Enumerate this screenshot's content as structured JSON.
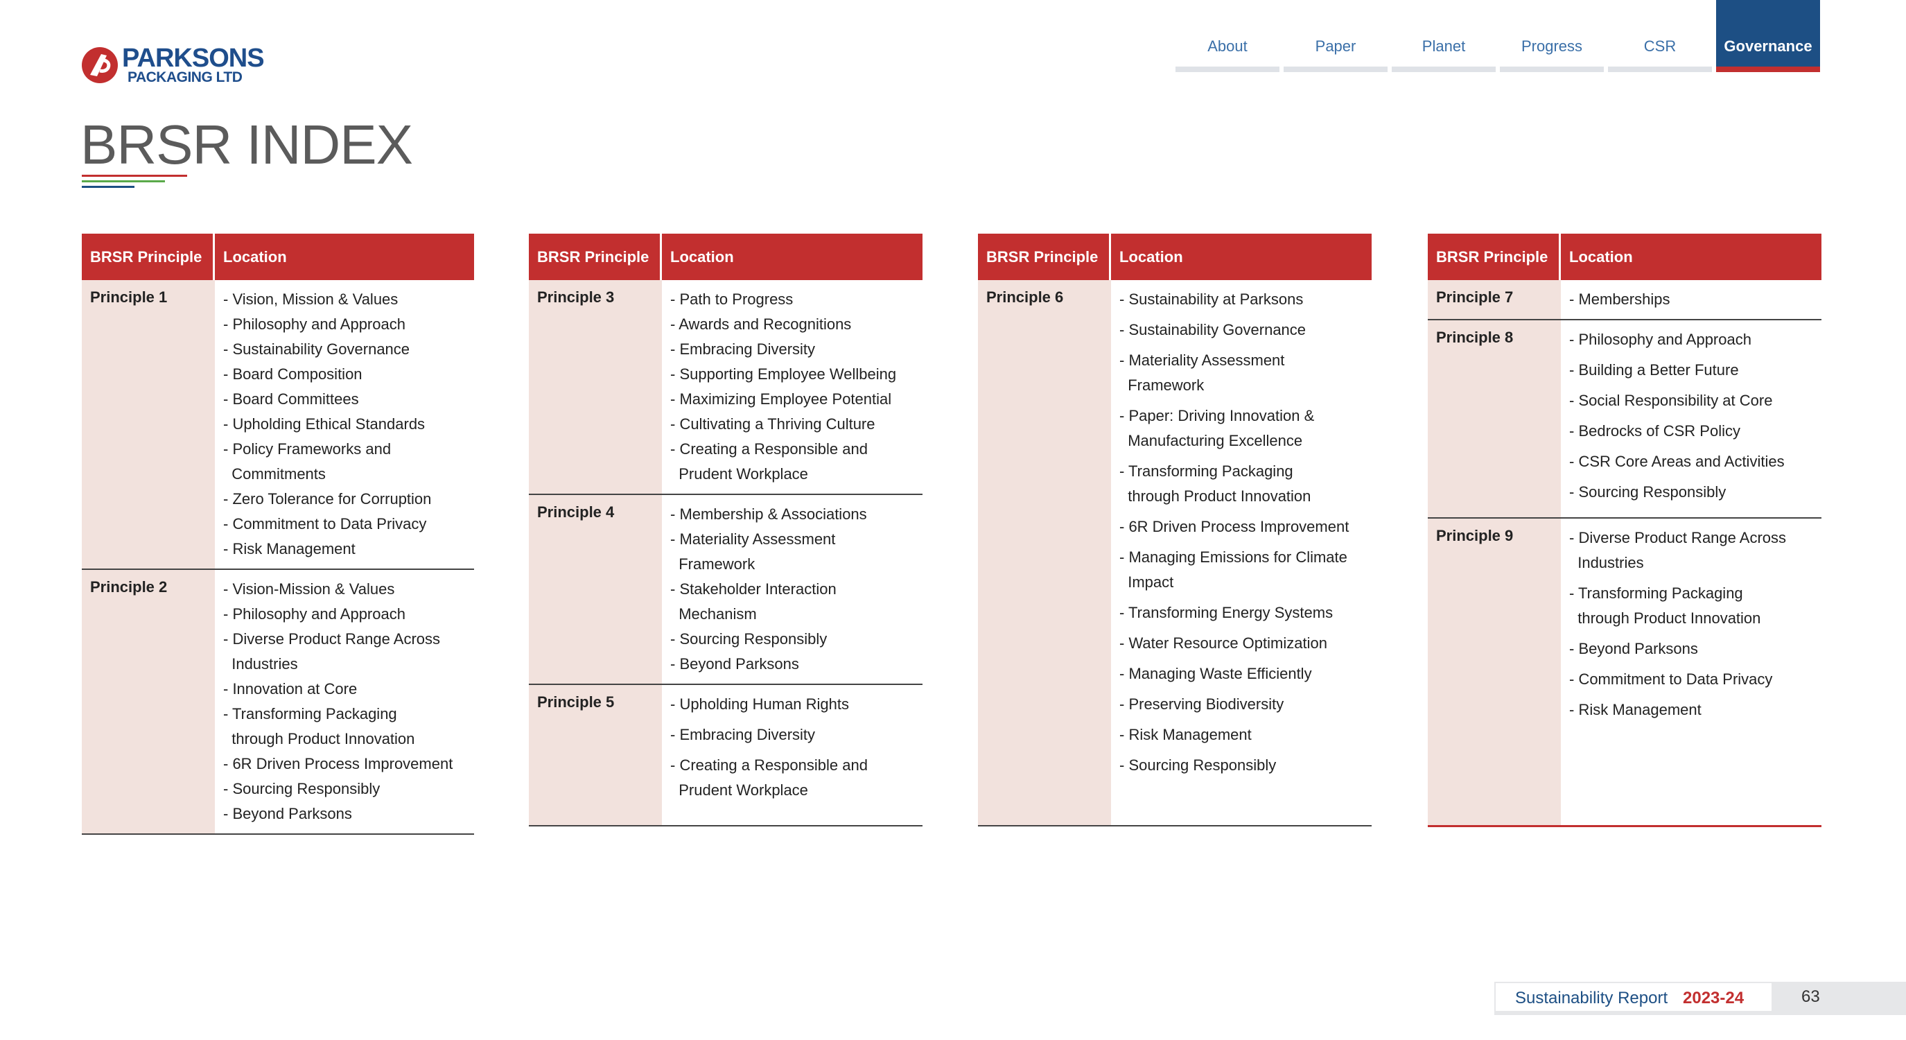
{
  "brand": {
    "name": "PARKSONS",
    "sub": "PACKAGING LTD",
    "red": "#c22f2f",
    "blue": "#1d4f84"
  },
  "nav": [
    {
      "label": "About",
      "active": false
    },
    {
      "label": "Paper",
      "active": false
    },
    {
      "label": "Planet",
      "active": false
    },
    {
      "label": "Progress",
      "active": false
    },
    {
      "label": "CSR",
      "active": false
    },
    {
      "label": "Governance",
      "active": true
    }
  ],
  "page_title": "BRSR INDEX",
  "table_headers": {
    "principle": "BRSR Principle",
    "location": "Location"
  },
  "tables": [
    {
      "rows": [
        {
          "principle": "Principle 1",
          "locations": [
            "- Vision, Mission & Values",
            "- Philosophy and Approach",
            "- Sustainability Governance",
            "- Board Composition",
            "- Board Committees",
            "- Upholding Ethical Standards",
            "- Policy Frameworks and\n  Commitments",
            "- Zero Tolerance for Corruption",
            "- Commitment to Data Privacy",
            "- Risk Management"
          ]
        },
        {
          "principle": "Principle 2",
          "locations": [
            "- Vision-Mission & Values",
            "- Philosophy and Approach",
            "- Diverse Product Range Across\n  Industries",
            "- Innovation at Core",
            "- Transforming Packaging\n  through Product Innovation",
            "- 6R Driven Process Improvement",
            "- Sourcing Responsibly",
            "- Beyond Parksons"
          ]
        }
      ]
    },
    {
      "rows": [
        {
          "principle": "Principle 3",
          "locations": [
            "- Path to Progress",
            "- Awards and Recognitions",
            "- Embracing Diversity",
            "- Supporting Employee Wellbeing",
            "- Maximizing Employee Potential",
            "- Cultivating a Thriving Culture",
            "- Creating a Responsible and\n  Prudent Workplace"
          ]
        },
        {
          "principle": "Principle 4",
          "locations": [
            "- Membership & Associations",
            "- Materiality Assessment\n  Framework",
            "- Stakeholder Interaction\n  Mechanism",
            "- Sourcing Responsibly",
            "- Beyond Parksons"
          ]
        },
        {
          "principle": "Principle 5",
          "spaced": true,
          "locations": [
            "- Upholding Human Rights",
            "- Embracing Diversity",
            "- Creating a Responsible and\n  Prudent Workplace"
          ]
        }
      ]
    },
    {
      "rows": [
        {
          "principle": "Principle 6",
          "spaced": true,
          "locations": [
            "- Sustainability at Parksons",
            "- Sustainability Governance",
            "- Materiality Assessment\n  Framework",
            "- Paper: Driving Innovation &\n  Manufacturing Excellence",
            "- Transforming Packaging\n  through Product Innovation",
            "- 6R Driven Process Improvement",
            "- Managing Emissions for Climate\n  Impact",
            "- Transforming Energy Systems",
            "- Water Resource Optimization",
            "- Managing Waste Efficiently",
            "- Preserving Biodiversity",
            "- Risk Management",
            "- Sourcing Responsibly"
          ]
        }
      ]
    },
    {
      "rows": [
        {
          "principle": "Principle 7",
          "locations": [
            "- Memberships"
          ]
        },
        {
          "principle": "Principle 8",
          "spaced": true,
          "locations": [
            "- Philosophy and Approach",
            "- Building a Better Future",
            "- Social Responsibility at Core",
            "- Bedrocks of CSR Policy",
            "- CSR Core Areas and Activities",
            "- Sourcing Responsibly"
          ]
        },
        {
          "principle": "Principle 9",
          "spaced": true,
          "locations": [
            "- Diverse Product Range Across\n  Industries",
            "- Transforming Packaging\n  through Product Innovation",
            "- Beyond Parksons",
            "- Commitment to Data Privacy",
            "- Risk Management"
          ]
        }
      ]
    }
  ],
  "footer": {
    "label": "Sustainability Report",
    "year": "2023-24",
    "page": "63"
  }
}
